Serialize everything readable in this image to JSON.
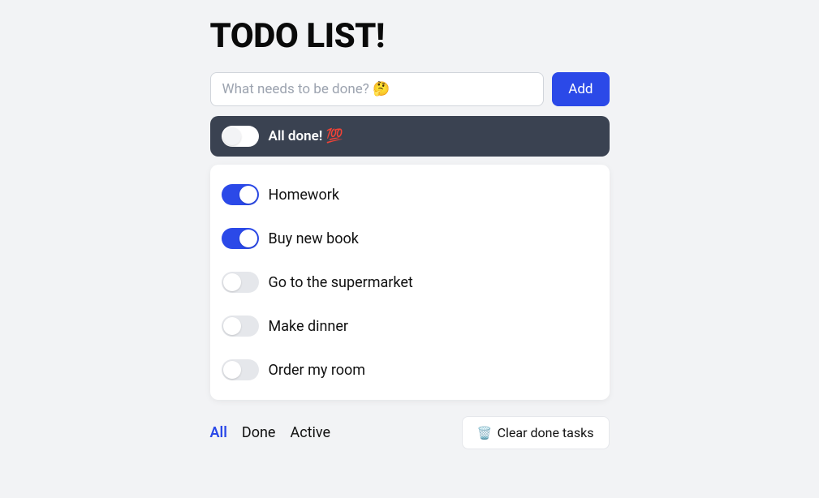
{
  "title": "TODO LIST!",
  "input": {
    "placeholder": "What needs to be done? 🤔",
    "value": ""
  },
  "add_button": "Add",
  "all_done": {
    "label": "All done! 💯",
    "checked": false
  },
  "tasks": [
    {
      "label": "Homework",
      "done": true
    },
    {
      "label": "Buy new book",
      "done": true
    },
    {
      "label": "Go to the supermarket",
      "done": false
    },
    {
      "label": "Make dinner",
      "done": false
    },
    {
      "label": "Order my room",
      "done": false
    }
  ],
  "filters": {
    "all": "All",
    "done": "Done",
    "active": "Active",
    "selected": "all"
  },
  "clear_button": {
    "icon": "🗑️",
    "label": "Clear done tasks"
  }
}
